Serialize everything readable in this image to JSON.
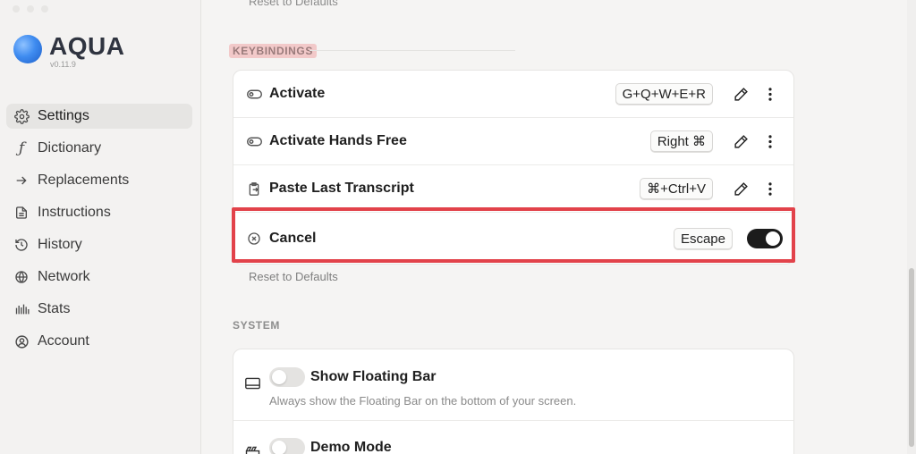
{
  "app": {
    "name": "AQUA",
    "version": "v0.11.9"
  },
  "sidebar": {
    "items": [
      {
        "label": "Settings",
        "icon": "gear-icon",
        "active": true
      },
      {
        "label": "Dictionary",
        "icon": "script-f-icon"
      },
      {
        "label": "Replacements",
        "icon": "arrow-right-icon"
      },
      {
        "label": "Instructions",
        "icon": "document-icon"
      },
      {
        "label": "History",
        "icon": "history-icon"
      },
      {
        "label": "Network",
        "icon": "globe-icon"
      },
      {
        "label": "Stats",
        "icon": "bars-icon"
      },
      {
        "label": "Account",
        "icon": "user-circle-icon"
      }
    ]
  },
  "main": {
    "reset_top": "Reset to Defaults",
    "keybindings": {
      "title": "KEYBINDINGS",
      "rows": [
        {
          "label": "Activate",
          "key": "G+Q+W+E+R",
          "icon": "toggle-pill-icon"
        },
        {
          "label": "Activate Hands Free",
          "key": "Right ⌘",
          "icon": "toggle-pill-icon"
        },
        {
          "label": "Paste Last Transcript",
          "key": "⌘+Ctrl+V",
          "icon": "clipboard-icon"
        },
        {
          "label": "Cancel",
          "key": "Escape",
          "icon": "x-circle-icon",
          "enabled": true
        }
      ],
      "reset": "Reset to Defaults"
    },
    "system": {
      "title": "SYSTEM",
      "rows": [
        {
          "label": "Show Floating Bar",
          "description": "Always show the Floating Bar on the bottom of your screen.",
          "icon": "card-icon",
          "enabled": false
        },
        {
          "label": "Demo Mode",
          "icon": "clapper-icon",
          "enabled": false
        }
      ]
    }
  },
  "colors": {
    "highlight": "#e2424a",
    "toggle_on": "#1c1c1c",
    "accent": "#3f8cf0"
  }
}
